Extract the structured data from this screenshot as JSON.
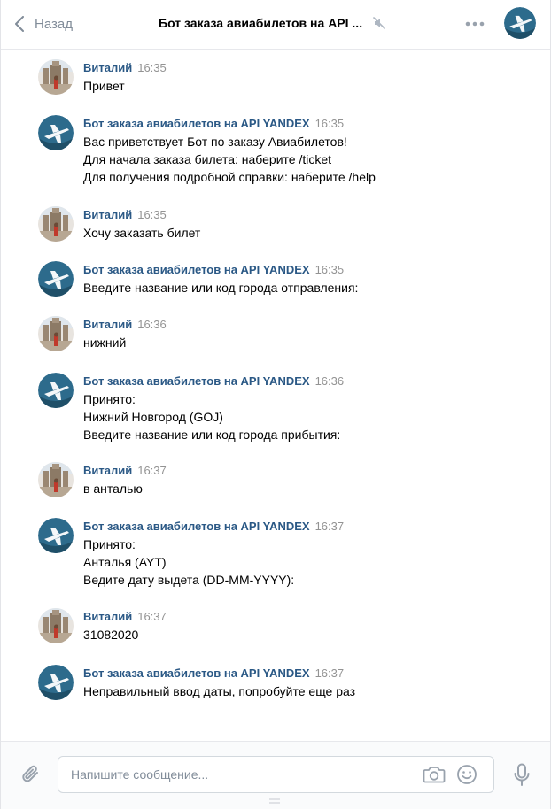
{
  "header": {
    "back_label": "Назад",
    "title": "Бот заказа авиабилетов на API ...",
    "icons": [
      "chevron-left-icon",
      "muted-speaker-icon",
      "more-horizontal-icon"
    ]
  },
  "messages": [
    {
      "sender": "Виталий",
      "time": "16:35",
      "kind": "user",
      "lines": [
        "Привет"
      ]
    },
    {
      "sender": "Бот заказа авиабилетов на API YANDEX",
      "time": "16:35",
      "kind": "bot",
      "lines": [
        "Вас приветствует Бот по заказу Авиабилетов!",
        "Для начала заказа билета: наберите /ticket",
        "Для получения подробной справки: наберите /help"
      ]
    },
    {
      "sender": "Виталий",
      "time": "16:35",
      "kind": "user",
      "lines": [
        "Хочу заказать билет"
      ]
    },
    {
      "sender": "Бот заказа авиабилетов на API YANDEX",
      "time": "16:35",
      "kind": "bot",
      "lines": [
        "Введите название или код города отправления:"
      ]
    },
    {
      "sender": "Виталий",
      "time": "16:36",
      "kind": "user",
      "lines": [
        "нижний"
      ]
    },
    {
      "sender": "Бот заказа авиабилетов на API YANDEX",
      "time": "16:36",
      "kind": "bot",
      "lines": [
        "Принято:",
        "Нижний Новгород (GOJ)",
        "Введите название или код города прибытия:"
      ]
    },
    {
      "sender": "Виталий",
      "time": "16:37",
      "kind": "user",
      "lines": [
        "в анталью"
      ]
    },
    {
      "sender": "Бот заказа авиабилетов на API YANDEX",
      "time": "16:37",
      "kind": "bot",
      "lines": [
        "Принято:",
        "Анталья (AYT)",
        "Ведите дату выдета (DD-MM-YYYY):"
      ]
    },
    {
      "sender": "Виталий",
      "time": "16:37",
      "kind": "user",
      "lines": [
        "31082020"
      ]
    },
    {
      "sender": "Бот заказа авиабилетов на API YANDEX",
      "time": "16:37",
      "kind": "bot",
      "lines": [
        "Неправильный ввод даты, попробуйте еще раз"
      ]
    }
  ],
  "composer": {
    "placeholder": "Напишите сообщение...",
    "value": "",
    "icons": [
      "paperclip-icon",
      "camera-icon",
      "smile-icon",
      "microphone-icon"
    ]
  },
  "colors": {
    "sender_name": "#2a5885",
    "timestamp": "#939393",
    "muted_ui": "#818c99",
    "bot_avatar_bg": "#2d6b8c"
  }
}
